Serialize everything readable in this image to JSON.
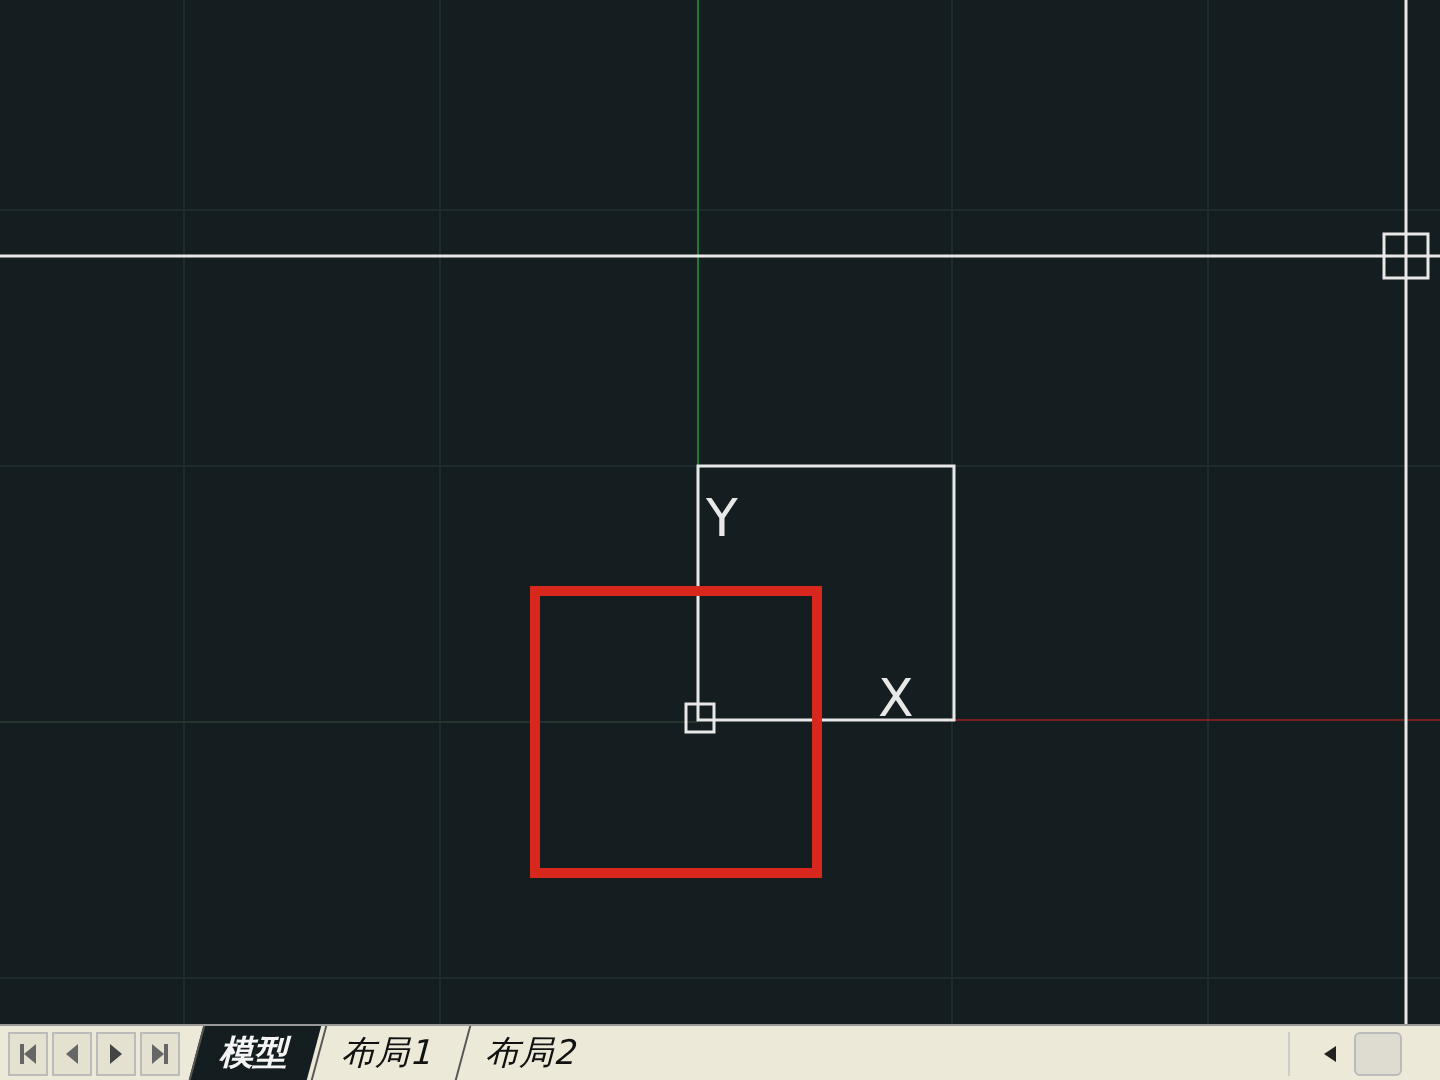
{
  "ucs_icon": {
    "y_label": "Y",
    "x_label": "X"
  },
  "layout_tabs": [
    {
      "label": "模型",
      "selected": true
    },
    {
      "label": "布局1",
      "selected": false
    },
    {
      "label": "布局2",
      "selected": false
    }
  ]
}
